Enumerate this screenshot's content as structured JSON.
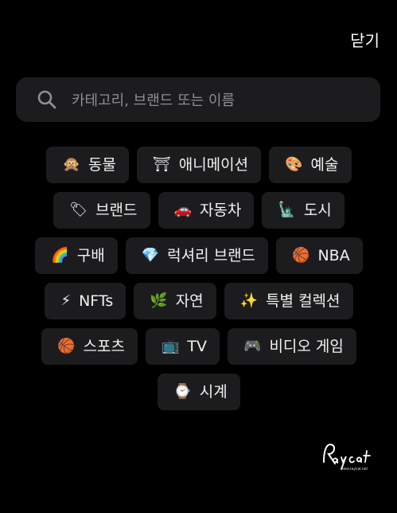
{
  "header": {
    "close_label": "닫기"
  },
  "search": {
    "placeholder": "카테고리, 브랜드 또는 이름",
    "icon": "search-icon"
  },
  "categories": [
    [
      {
        "emoji": "🙊",
        "icon": "monkey-icon",
        "label": "동물"
      },
      {
        "emoji": "⛩",
        "icon": "torii-gate-icon",
        "label": "애니메이션"
      },
      {
        "emoji": "🎨",
        "icon": "palette-icon",
        "label": "예술"
      }
    ],
    [
      {
        "emoji": "🏷",
        "icon": "tag-icon",
        "label": "브랜드"
      },
      {
        "emoji": "🚗",
        "icon": "car-icon",
        "label": "자동차"
      },
      {
        "emoji": "🗽",
        "icon": "statue-of-liberty-icon",
        "label": "도시"
      }
    ],
    [
      {
        "emoji": "🌈",
        "icon": "rainbow-icon",
        "label": "구배"
      },
      {
        "emoji": "💎",
        "icon": "gem-icon",
        "label": "럭셔리 브랜드"
      },
      {
        "emoji": "🏀",
        "icon": "basketball-icon",
        "label": "NBA"
      }
    ],
    [
      {
        "emoji": "⚡",
        "icon": "lightning-icon",
        "label": "NFTs"
      },
      {
        "emoji": "🌿",
        "icon": "herb-icon",
        "label": "자연"
      },
      {
        "emoji": "✨",
        "icon": "sparkles-icon",
        "label": "특별 컬렉션"
      }
    ],
    [
      {
        "emoji": "🏀",
        "icon": "basketball-icon",
        "label": "스포츠"
      },
      {
        "emoji": "📺",
        "icon": "television-icon",
        "label": "TV"
      },
      {
        "emoji": "🎮",
        "icon": "game-controller-icon",
        "label": "비디오 게임"
      }
    ],
    [
      {
        "emoji": "⌚",
        "icon": "watch-icon",
        "label": "시계"
      }
    ]
  ],
  "watermark": {
    "logo_text": "Raycat",
    "url_text": "www.raycat.net"
  }
}
